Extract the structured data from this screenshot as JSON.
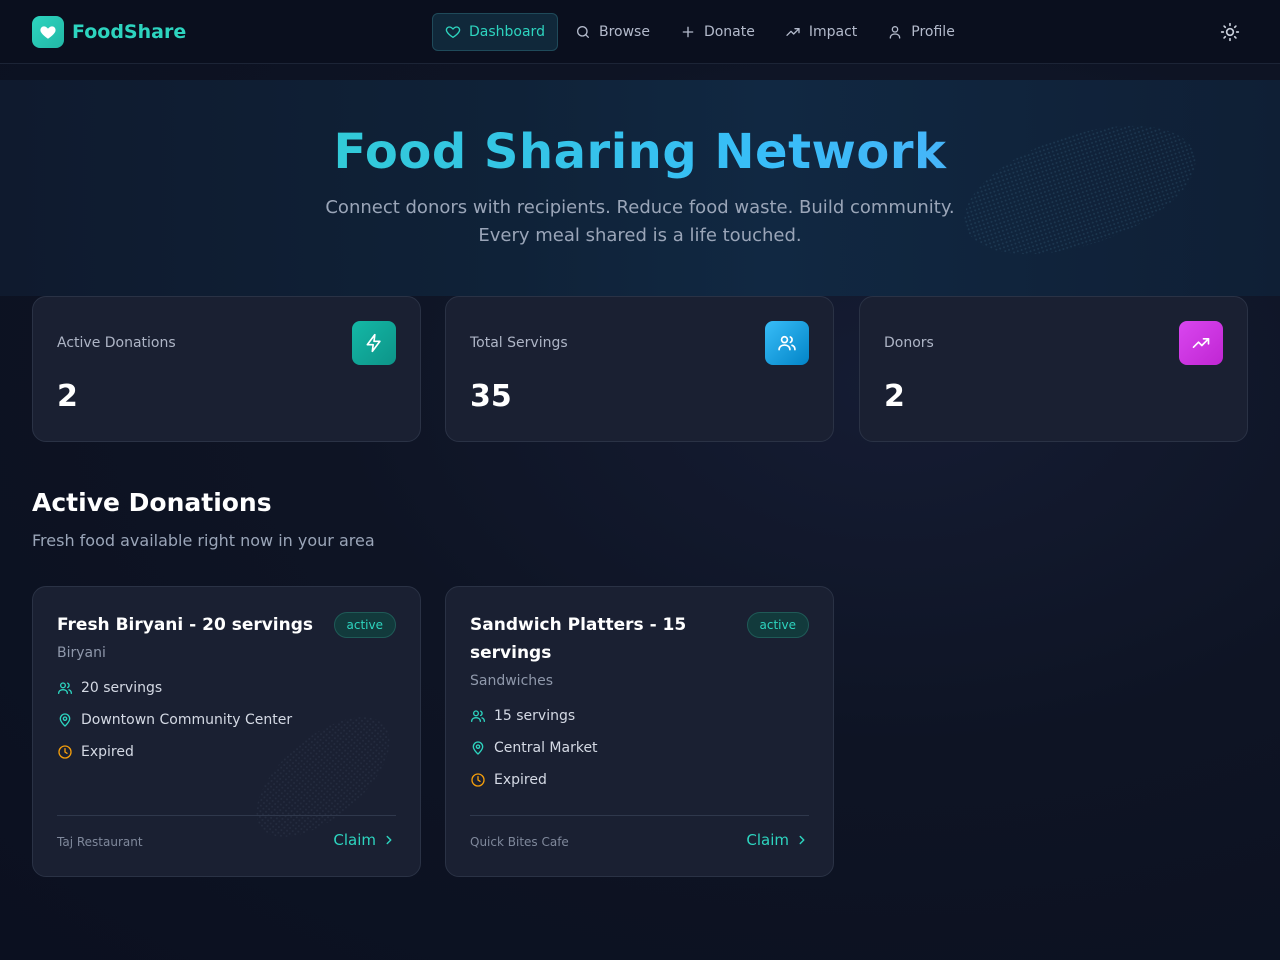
{
  "brand": {
    "name": "FoodShare"
  },
  "nav": {
    "items": [
      {
        "label": "Dashboard",
        "icon": "heart-icon",
        "active": true
      },
      {
        "label": "Browse",
        "icon": "search-icon"
      },
      {
        "label": "Donate",
        "icon": "plus-icon"
      },
      {
        "label": "Impact",
        "icon": "trending-up-icon"
      },
      {
        "label": "Profile",
        "icon": "user-icon"
      }
    ]
  },
  "hero": {
    "title": "Food Sharing Network",
    "subtitle_line1": "Connect donors with recipients. Reduce food waste. Build community.",
    "subtitle_line2": "Every meal shared is a life touched."
  },
  "stats": [
    {
      "label": "Active Donations",
      "value": "2",
      "icon": "zap-icon",
      "color": "#14b8a6"
    },
    {
      "label": "Total Servings",
      "value": "35",
      "icon": "users-icon",
      "color": "#0ea5e9"
    },
    {
      "label": "Donors",
      "value": "2",
      "icon": "trending-up-icon",
      "color": "#c026d3"
    }
  ],
  "section": {
    "title": "Active Donations",
    "subtitle": "Fresh food available right now in your area"
  },
  "donations": [
    {
      "title": "Fresh Biryani - 20 servings",
      "status": "active",
      "category": "Biryani",
      "servings": "20 servings",
      "location": "Downtown Community Center",
      "expiry": "Expired",
      "donor": "Taj Restaurant",
      "action": "Claim"
    },
    {
      "title": "Sandwich Platters - 15 servings",
      "status": "active",
      "category": "Sandwiches",
      "servings": "15 servings",
      "location": "Central Market",
      "expiry": "Expired",
      "donor": "Quick Bites Cafe",
      "action": "Claim"
    }
  ],
  "colors": {
    "accent": "#2dd4bf",
    "expiry": "#f59e0b"
  }
}
